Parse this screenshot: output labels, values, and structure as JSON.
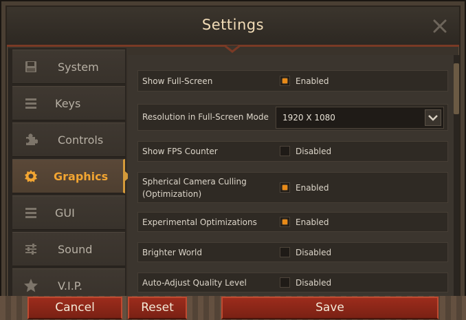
{
  "window": {
    "title": "Settings"
  },
  "sidebar": {
    "items": [
      {
        "label": "System",
        "icon": "disk-icon"
      },
      {
        "label": "Keys",
        "icon": "list-icon"
      },
      {
        "label": "Controls",
        "icon": "puzzle-icon"
      },
      {
        "label": "Graphics",
        "icon": "gear-icon"
      },
      {
        "label": "GUI",
        "icon": "list-icon"
      },
      {
        "label": "Sound",
        "icon": "sliders-icon"
      },
      {
        "label": "V.I.P.",
        "icon": "star-icon"
      }
    ],
    "active": "Graphics"
  },
  "settings": [
    {
      "label": "Show Full-Screen",
      "state": "Enabled",
      "checked": true
    },
    {
      "label": "Resolution in Full-Screen Mode",
      "value": "1920 X 1080"
    },
    {
      "label": "Show FPS Counter",
      "state": "Disabled",
      "checked": false
    },
    {
      "label": "Spherical Camera Culling",
      "label2": "(Optimization)",
      "state": "Enabled",
      "checked": true
    },
    {
      "label": "Experimental Optimizations",
      "state": "Enabled",
      "checked": true
    },
    {
      "label": "Brighter World",
      "state": "Disabled",
      "checked": false
    },
    {
      "label": "Auto-Adjust Quality Level",
      "state": "Disabled",
      "checked": false
    }
  ],
  "buttons": {
    "cancel": "Cancel",
    "reset": "Reset",
    "save": "Save"
  },
  "colors": {
    "accent": "#f2a532",
    "checkbox_on": "#e88a18",
    "button_red": "#8c2718"
  }
}
